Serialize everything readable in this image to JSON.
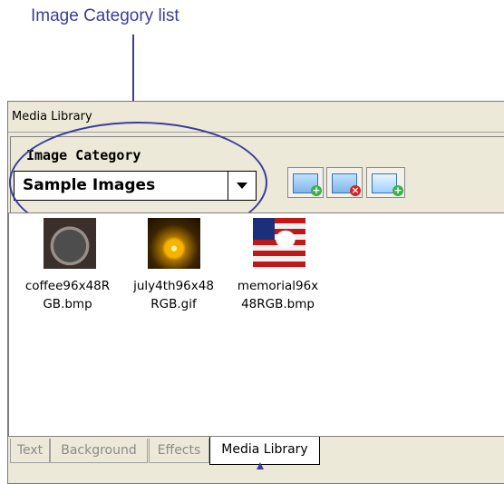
{
  "callout": {
    "title": "Image Category list"
  },
  "window": {
    "title": "Media Library"
  },
  "category": {
    "label": "Image Category",
    "selected": "Sample Images"
  },
  "toolbar": {
    "buttons": [
      {
        "icon": "add-image-icon"
      },
      {
        "icon": "delete-image-icon"
      },
      {
        "icon": "add-picture-icon"
      }
    ]
  },
  "images": [
    {
      "line1": "coffee96x48R",
      "line2": "GB.bmp"
    },
    {
      "line1": "july4th96x48",
      "line2": "RGB.gif"
    },
    {
      "line1": "memorial96x",
      "line2": "48RGB.bmp"
    }
  ],
  "tabs": [
    {
      "label": "Text"
    },
    {
      "label": "Background"
    },
    {
      "label": "Effects"
    },
    {
      "label": "Media Library"
    }
  ],
  "colors": {
    "callout": "#3b3d9a",
    "panel": "#ece9d8"
  }
}
